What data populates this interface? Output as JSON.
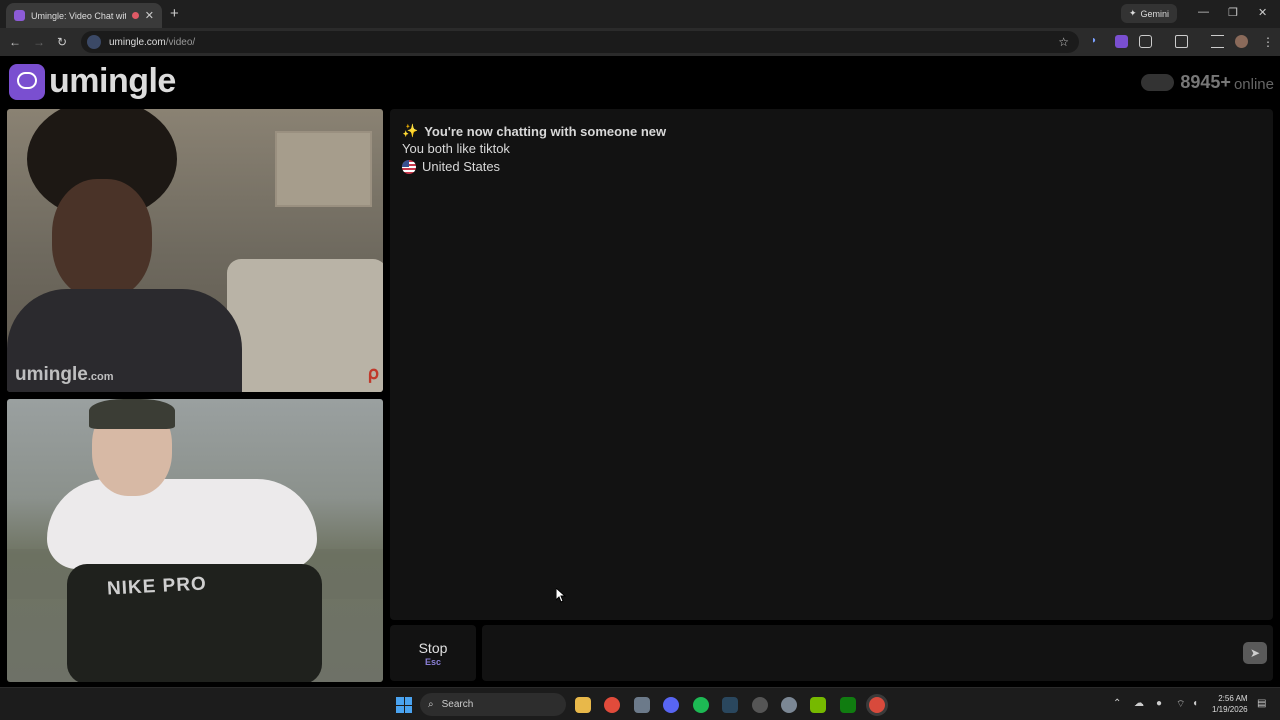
{
  "browser": {
    "tab_title": "Umingle: Video Chat with St",
    "close_tab": "✕",
    "new_tab": "+",
    "gemini_label": "Gemini",
    "url_host": "umingle.com",
    "url_path": "/video/",
    "window_controls": [
      "—",
      "❐",
      "✕"
    ]
  },
  "site": {
    "logo_text": "umingle",
    "online_count": "8945+",
    "online_label": "online",
    "watermark": "umingle",
    "watermark_suffix": ".com",
    "video2_shorts_text": "NIKE PRO"
  },
  "chat": {
    "new_chat_msg": "You're now chatting with someone new",
    "interest_msg": "You both like tiktok",
    "country": "United States"
  },
  "controls": {
    "stop_label": "Stop",
    "stop_key": "Esc",
    "send_icon": "➤"
  },
  "taskbar": {
    "search_placeholder": "Search",
    "time": "2:56 AM",
    "date": "1/19/2026"
  },
  "colors": {
    "accent": "#7a4fd0",
    "background": "#000000",
    "panel": "#121212"
  }
}
